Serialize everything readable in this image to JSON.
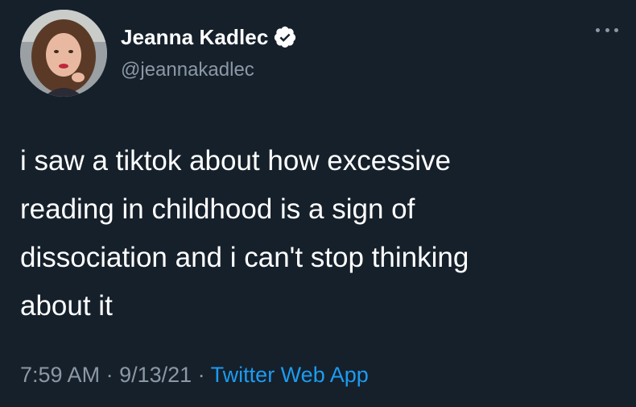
{
  "author": {
    "display_name": "Jeanna Kadlec",
    "handle": "@jeannakadlec",
    "verified": true
  },
  "tweet": {
    "text": "i saw a tiktok about how excessive\nreading in childhood is a sign of\ndissociation and i can't stop thinking\nabout it"
  },
  "meta": {
    "time": "7:59 AM",
    "separator": " · ",
    "date": "9/13/21",
    "source": "Twitter Web App"
  },
  "icons": {
    "verified": "verified-badge-icon",
    "more": "more-options-icon"
  },
  "colors": {
    "background": "#15202b",
    "primary_text": "#ffffff",
    "secondary_text": "#8b98a5",
    "link": "#1d9bf0"
  }
}
